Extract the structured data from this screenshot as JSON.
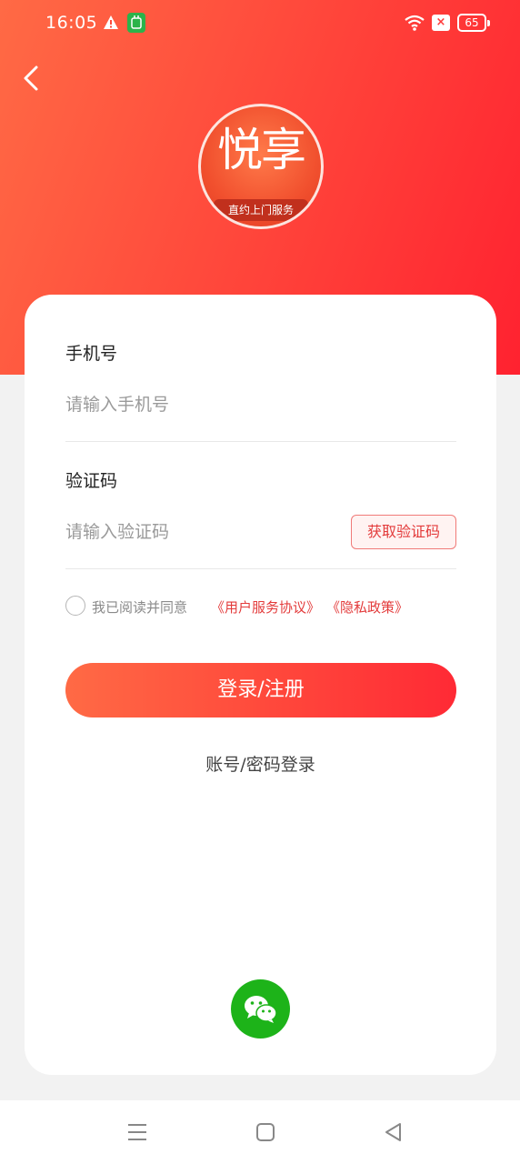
{
  "status_bar": {
    "time": "16:05",
    "battery": "65",
    "icons": [
      "warning-icon",
      "app-notification-icon",
      "wifi-icon",
      "no-sim-icon",
      "battery-icon"
    ]
  },
  "logo": {
    "name": "悦享",
    "tagline": "直约上门服务"
  },
  "form": {
    "phone_label": "手机号",
    "phone_placeholder": "请输入手机号",
    "phone_value": "",
    "code_label": "验证码",
    "code_placeholder": "请输入验证码",
    "code_value": "",
    "get_code_label": "获取验证码"
  },
  "agreement": {
    "text": "我已阅读并同意",
    "user_agreement": "《用户服务协议》",
    "privacy_policy": "《隐私政策》",
    "checked": false
  },
  "actions": {
    "login_label": "登录/注册",
    "alt_login_label": "账号/密码登录"
  },
  "colors": {
    "brand_red": "#ff3b3b",
    "gradient_start": "#ff6a45",
    "gradient_end": "#ff2230",
    "wechat_green": "#1db319"
  }
}
